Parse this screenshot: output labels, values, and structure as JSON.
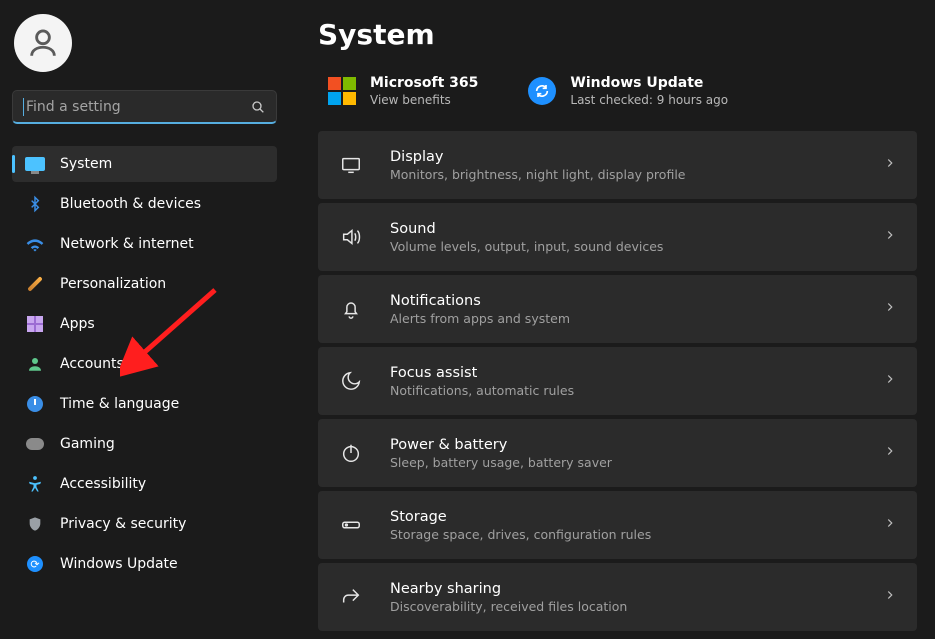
{
  "search": {
    "placeholder": "Find a setting"
  },
  "nav": [
    {
      "id": "system",
      "label": "System"
    },
    {
      "id": "bluetooth",
      "label": "Bluetooth & devices"
    },
    {
      "id": "network",
      "label": "Network & internet"
    },
    {
      "id": "personalization",
      "label": "Personalization"
    },
    {
      "id": "apps",
      "label": "Apps"
    },
    {
      "id": "accounts",
      "label": "Accounts"
    },
    {
      "id": "time",
      "label": "Time & language"
    },
    {
      "id": "gaming",
      "label": "Gaming"
    },
    {
      "id": "accessibility",
      "label": "Accessibility"
    },
    {
      "id": "privacy",
      "label": "Privacy & security"
    },
    {
      "id": "update",
      "label": "Windows Update"
    }
  ],
  "page": {
    "title": "System"
  },
  "info": {
    "ms365": {
      "title": "Microsoft 365",
      "sub": "View benefits"
    },
    "update": {
      "title": "Windows Update",
      "sub": "Last checked: 9 hours ago"
    }
  },
  "cards": [
    {
      "id": "display",
      "title": "Display",
      "sub": "Monitors, brightness, night light, display profile"
    },
    {
      "id": "sound",
      "title": "Sound",
      "sub": "Volume levels, output, input, sound devices"
    },
    {
      "id": "notif",
      "title": "Notifications",
      "sub": "Alerts from apps and system"
    },
    {
      "id": "focus",
      "title": "Focus assist",
      "sub": "Notifications, automatic rules"
    },
    {
      "id": "power",
      "title": "Power & battery",
      "sub": "Sleep, battery usage, battery saver"
    },
    {
      "id": "storage",
      "title": "Storage",
      "sub": "Storage space, drives, configuration rules"
    },
    {
      "id": "nearby",
      "title": "Nearby sharing",
      "sub": "Discoverability, received files location"
    }
  ]
}
